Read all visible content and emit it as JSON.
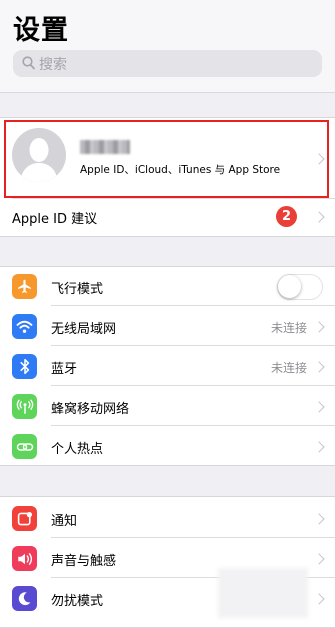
{
  "header": {
    "title": "设置",
    "search_placeholder": "搜索"
  },
  "account": {
    "subtitle": "Apple ID、iCloud、iTunes 与 App Store",
    "suggestion_label": "Apple ID 建议",
    "suggestion_badge": "2"
  },
  "connectivity": [
    {
      "label": "飞行模式",
      "icon": "airplane-icon",
      "color": "#f7982c",
      "toggle": false
    },
    {
      "label": "无线局域网",
      "icon": "wifi-icon",
      "color": "#2f7bf6",
      "value": "未连接"
    },
    {
      "label": "蓝牙",
      "icon": "bluetooth-icon",
      "color": "#2f7bf6",
      "value": "未连接"
    },
    {
      "label": "蜂窝移动网络",
      "icon": "cellular-icon",
      "color": "#5fd45a"
    },
    {
      "label": "个人热点",
      "icon": "hotspot-icon",
      "color": "#5fd45a"
    }
  ],
  "notifications": [
    {
      "label": "通知",
      "icon": "notifications-icon",
      "color": "#f0413a"
    },
    {
      "label": "声音与触感",
      "icon": "sound-icon",
      "color": "#f03c5b"
    },
    {
      "label": "勿扰模式",
      "icon": "moon-icon",
      "color": "#5a4ad2"
    }
  ]
}
